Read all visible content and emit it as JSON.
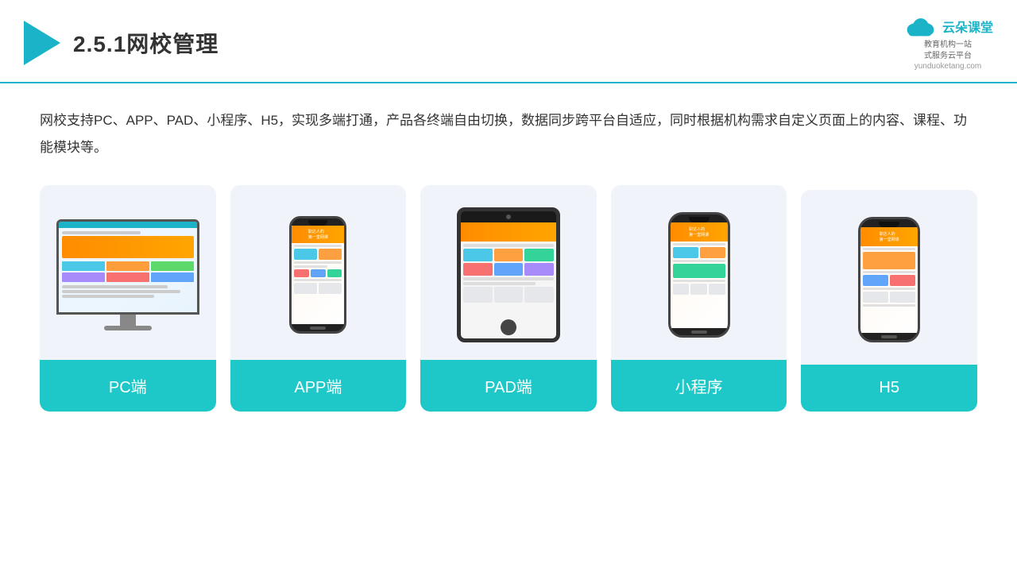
{
  "header": {
    "title": "2.5.1网校管理",
    "brand_name": "云朵课堂",
    "brand_url": "yunduoketang.com",
    "brand_slogan_line1": "教育机构一站",
    "brand_slogan_line2": "式服务云平台"
  },
  "description": "网校支持PC、APP、PAD、小程序、H5，实现多端打通，产品各终端自由切换，数据同步跨平台自适应，同时根据机构需求自定义页面上的内容、课程、功能模块等。",
  "devices": [
    {
      "id": "pc",
      "label": "PC端",
      "type": "pc"
    },
    {
      "id": "app",
      "label": "APP端",
      "type": "phone"
    },
    {
      "id": "pad",
      "label": "PAD端",
      "type": "tablet"
    },
    {
      "id": "miniprogram",
      "label": "小程序",
      "type": "phone"
    },
    {
      "id": "h5",
      "label": "H5",
      "type": "phone"
    }
  ],
  "colors": {
    "teal": "#1fc8c8",
    "accent": "#1ab3c8",
    "orange": "#ff8c00",
    "bg_card": "#f0f4fa"
  }
}
